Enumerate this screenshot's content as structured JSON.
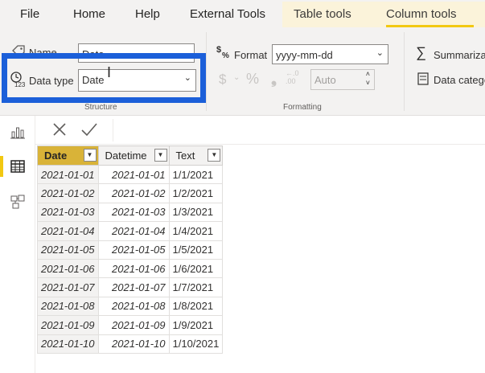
{
  "menu": {
    "tabs": [
      "File",
      "Home",
      "Help",
      "External Tools"
    ],
    "contextual_tabs": [
      "Table tools",
      "Column tools"
    ]
  },
  "ribbon": {
    "structure": {
      "name_label": "Name",
      "name_value": "Date",
      "datatype_label": "Data type",
      "datatype_value": "Date",
      "group_label": "Structure"
    },
    "formatting": {
      "format_label": "Format",
      "format_value": "yyyy-mm-dd",
      "decimals_value": "Auto",
      "group_label": "Formatting"
    },
    "properties": {
      "summarize_label": "Summarization",
      "category_label": "Data category"
    }
  },
  "table": {
    "columns": [
      "Date",
      "Datetime",
      "Text"
    ],
    "rows": [
      [
        "2021-01-01",
        "2021-01-01",
        "1/1/2021"
      ],
      [
        "2021-01-02",
        "2021-01-02",
        "1/2/2021"
      ],
      [
        "2021-01-03",
        "2021-01-03",
        "1/3/2021"
      ],
      [
        "2021-01-04",
        "2021-01-04",
        "1/4/2021"
      ],
      [
        "2021-01-05",
        "2021-01-05",
        "1/5/2021"
      ],
      [
        "2021-01-06",
        "2021-01-06",
        "1/6/2021"
      ],
      [
        "2021-01-07",
        "2021-01-07",
        "1/7/2021"
      ],
      [
        "2021-01-08",
        "2021-01-08",
        "1/8/2021"
      ],
      [
        "2021-01-09",
        "2021-01-09",
        "1/9/2021"
      ],
      [
        "2021-01-10",
        "2021-01-10",
        "1/10/2021"
      ]
    ]
  },
  "icons": {
    "name": "tag-icon",
    "datatype": "clock-123-icon",
    "format": "dollar-percent-icon",
    "summarize": "sigma-icon",
    "category": "category-icon",
    "report": "bar-chart-icon",
    "data": "table-icon",
    "model": "model-icon",
    "cancel": "close-icon",
    "commit": "check-icon"
  },
  "colors": {
    "accent": "#f2c811",
    "highlight_box": "#1b5fd9",
    "selected_header": "#d9b338",
    "contextual_tab_bg": "#fbf3da"
  }
}
